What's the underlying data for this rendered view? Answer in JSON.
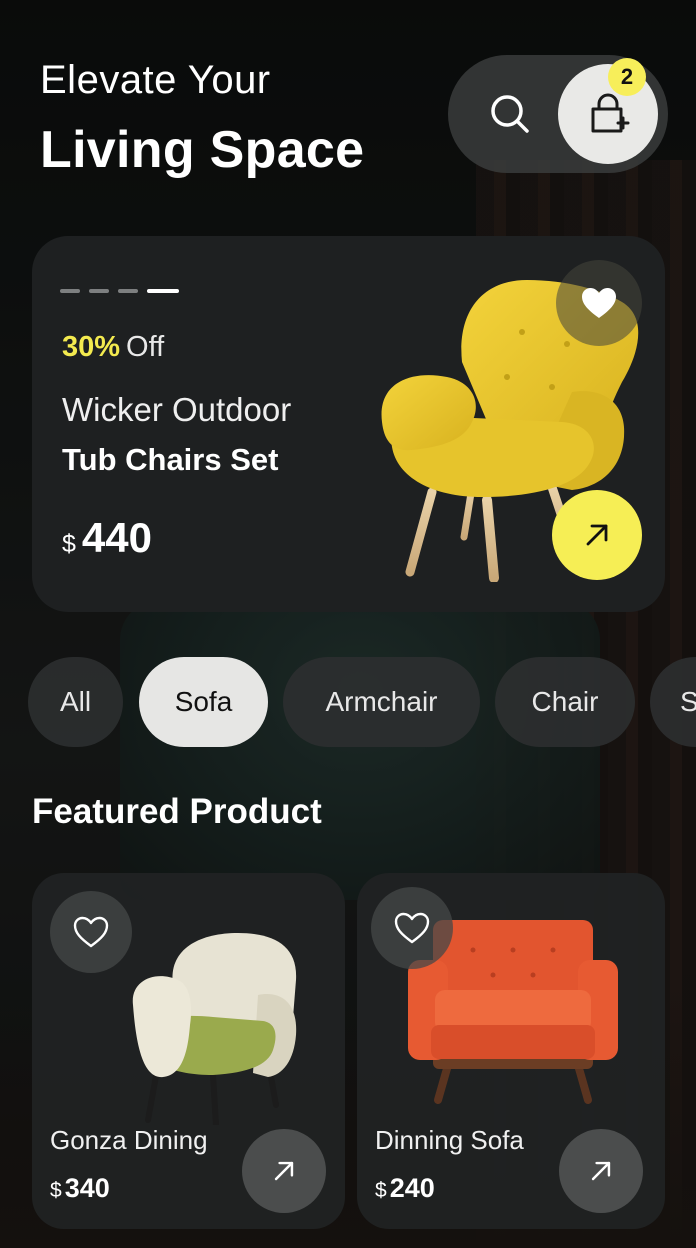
{
  "header": {
    "title_line1": "Elevate Your",
    "title_line2": "Living Space",
    "cart_count": "2",
    "icons": {
      "search": "search-icon",
      "cart": "shopping-bag-plus-icon"
    }
  },
  "hero": {
    "carousel_total": 4,
    "carousel_active": 4,
    "discount_percent": "30%",
    "discount_suffix": "Off",
    "name_line1": "Wicker Outdoor",
    "name_line2": "Tub Chairs Set",
    "currency": "$",
    "price": "440",
    "accent_color": "#f6ee55"
  },
  "categories": [
    {
      "label": "All",
      "active": false
    },
    {
      "label": "Sofa",
      "active": true
    },
    {
      "label": "Armchair",
      "active": false
    },
    {
      "label": "Chair",
      "active": false
    },
    {
      "label": "S",
      "active": false
    }
  ],
  "featured": {
    "title": "Featured Product",
    "products": [
      {
        "name": "Gonza Dining",
        "currency": "$",
        "price": "340"
      },
      {
        "name": "Dinning Sofa",
        "currency": "$",
        "price": "240"
      }
    ]
  }
}
